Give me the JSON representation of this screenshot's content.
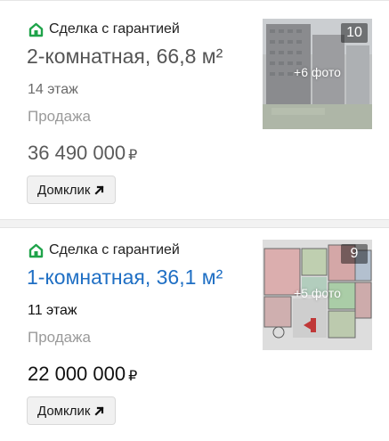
{
  "listings": [
    {
      "badge": "Сделка с гарантией",
      "title": "2-комнатная, 66,8 м²",
      "floor": "14 этаж",
      "deal_type": "Продажа",
      "price": "36 490 000",
      "currency": "₽",
      "button": "Домклик",
      "photo_count": "10",
      "more_photos": "+6 фото",
      "icon": "arrow-up-right-icon"
    },
    {
      "badge": "Сделка с гарантией",
      "title": "1-комнатная, 36,1 м²",
      "floor": "11 этаж",
      "deal_type": "Продажа",
      "price": "22 000 000",
      "currency": "₽",
      "button": "Домклик",
      "photo_count": "9",
      "more_photos": "+5 фото",
      "icon": "arrow-up-right-icon"
    }
  ],
  "colors": {
    "badge_green": "#1fa34a",
    "link_blue": "#1f6fc4"
  }
}
